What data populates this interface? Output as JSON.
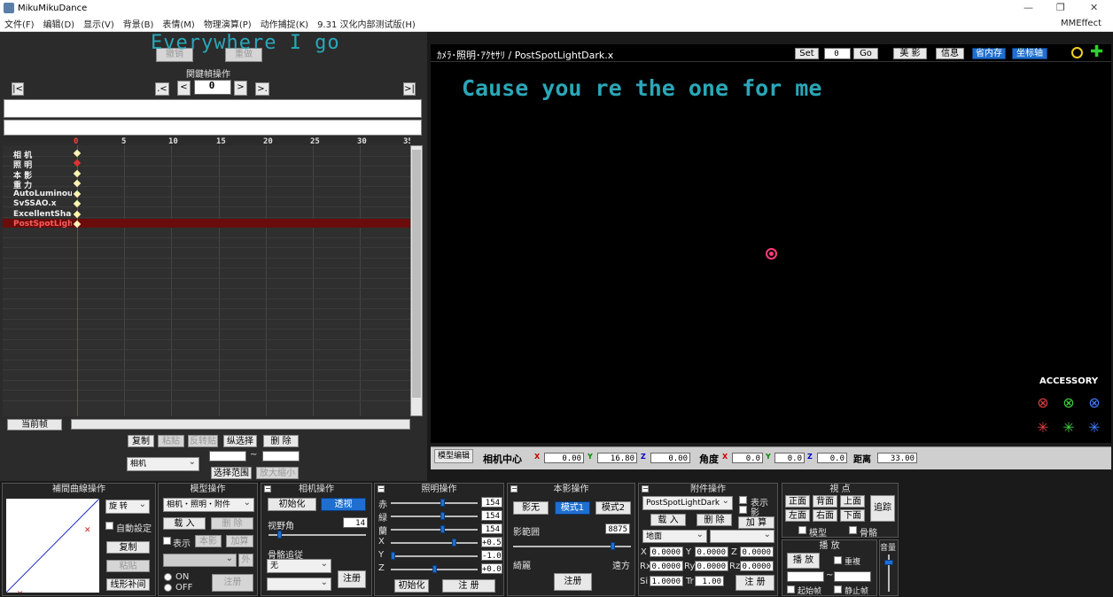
{
  "window": {
    "title": "MikuMikuDance",
    "mmeffect": "MMEffect"
  },
  "menu": [
    "文件(F)",
    "编辑(D)",
    "显示(V)",
    "背景(B)",
    "表情(M)",
    "物理演算(P)",
    "动作捕捉(K)",
    "9.31 汉化内部测试版(H)"
  ],
  "overlay": {
    "lyric_left": "Everywhere I go",
    "lyric_view": "Cause you re the one for me"
  },
  "left": {
    "undo": "撤销",
    "redo": "重做",
    "keyframe_ops_title": "関鍵幀操作",
    "frame_value": "0",
    "nav": {
      "first": "|<",
      "prev_key": ".<",
      "prev": "<",
      "next": ">",
      "next_key": ">.",
      "last": ">|"
    },
    "ruler": [
      "0",
      "5",
      "10",
      "15",
      "20",
      "25",
      "30",
      "35"
    ],
    "tracks": [
      "相 机",
      "照 明",
      "本 影",
      "重 力",
      "AutoLuminous",
      "SvSSAO.x",
      "ExcellentShadow",
      "PostSpotLightDark"
    ],
    "current_frame_btn": "当前帧",
    "copy": "复制",
    "paste": "粘贴",
    "reverse_paste": "反转贴",
    "range_select": "纵选择",
    "delete": "删 除",
    "camera_select": "相机",
    "select_range": "选择范围",
    "zoom_range": "放大缩小"
  },
  "view": {
    "header_title": "ｶﾒﾗ･照明･ｱｸｾｻﾘ / PostSpotLightDark.x",
    "set": "Set",
    "set_value": "0",
    "go": "Go",
    "shadow_btn": "美 影",
    "info": "信息",
    "save_mem": "省内存",
    "axis": "坐标轴",
    "accessory_label": "ACCESSORY"
  },
  "bottombar": {
    "model_edit": "模型编辑",
    "camera_center": "相机中心",
    "x": "0.00",
    "y": "16.80",
    "z": "0.00",
    "angle": "角度",
    "ax": "0.0",
    "ay": "0.0",
    "az": "0.0",
    "distance_label": "距离",
    "distance": "33.00"
  },
  "panels": {
    "interp": {
      "title": "補間曲線操作",
      "rot_select": "旋 转",
      "auto": "自動設定",
      "copy": "复制",
      "paste": "粘贴",
      "linear": "线形补间"
    },
    "model": {
      "title": "模型操作",
      "select": "相机・照明・附件",
      "load": "载 入",
      "delete": "删 除",
      "show": "表示",
      "this": "本影",
      "add": "加算",
      "ext": "外",
      "on": "ON",
      "off": "OFF",
      "register": "注册"
    },
    "camera": {
      "title": "相机操作",
      "init": "初始化",
      "perspective": "透视",
      "fov_label": "视野角",
      "fov": "14",
      "bone_follow": "骨骼追従",
      "none": "无",
      "register": "注册"
    },
    "light": {
      "title": "照明操作",
      "r_label": "赤",
      "g_label": "緑",
      "b_label": "蘭",
      "r": "154",
      "g": "154",
      "b": "154",
      "x": "+0.5",
      "y": "-1.0",
      "z": "+0.0",
      "init": "初始化",
      "register": "注 册"
    },
    "shadow": {
      "title": "本影操作",
      "none": "影无",
      "mode1": "模式1",
      "mode2": "模式2",
      "range_label": "影範囲",
      "range": "8875",
      "near": "綺麗",
      "far": "遠方",
      "register": "注册"
    },
    "accessory": {
      "title": "附件操作",
      "select": "PostSpotLightDark",
      "show": "表示",
      "shadow": "影",
      "load": "载 入",
      "delete": "删 除",
      "add": "加 算",
      "ground": "地面",
      "x": "0.0000",
      "y": "0.0000",
      "z": "0.0000",
      "rx": "0.0000",
      "ry": "0.0000",
      "rz": "0.0000",
      "si": "1.0000",
      "tr": "1.00",
      "register": "注 册"
    },
    "viewpoint": {
      "title": "視 点",
      "front": "正面",
      "back": "背面",
      "top": "上面",
      "left": "左面",
      "right": "右面",
      "bottom": "下面",
      "follow": "追踪",
      "model": "模型",
      "bone": "骨骼"
    },
    "play": {
      "title": "播 放",
      "play": "播 放",
      "repeat": "重複",
      "start": "起始帧",
      "stop": "静止帧",
      "volume": "音量"
    }
  }
}
